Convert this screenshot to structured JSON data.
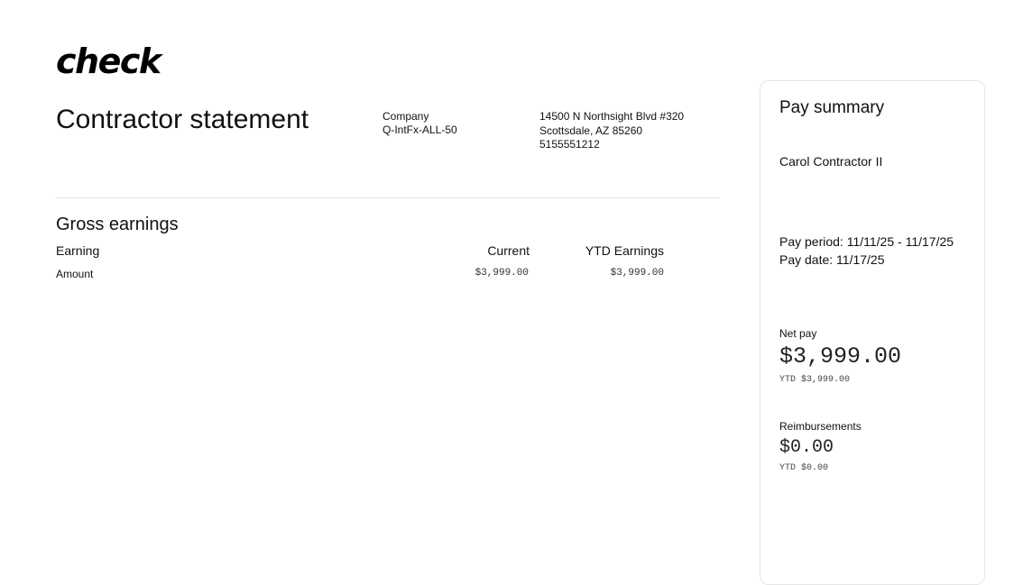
{
  "logo": "check",
  "statement_title": "Contractor statement",
  "company": {
    "label": "Company",
    "name": "Q-IntFx-ALL-50"
  },
  "address": {
    "line1": "14500 N Northsight Blvd #320",
    "line2": "Scottsdale, AZ 85260",
    "phone": "5155551212"
  },
  "gross_earnings": {
    "title": "Gross earnings",
    "columns": {
      "earning": "Earning",
      "current": "Current",
      "ytd": "YTD Earnings"
    },
    "rows": [
      {
        "label": "Amount",
        "current": "$3,999.00",
        "ytd": "$3,999.00"
      }
    ]
  },
  "summary": {
    "title": "Pay summary",
    "payee": "Carol Contractor II",
    "pay_period": "Pay period: 11/11/25 - 11/17/25",
    "pay_date": "Pay date: 11/17/25",
    "net_pay": {
      "label": "Net pay",
      "amount": "$3,999.00",
      "ytd": "YTD $3,999.00"
    },
    "reimbursements": {
      "label": "Reimbursements",
      "amount": "$0.00",
      "ytd": "YTD $0.00"
    }
  }
}
